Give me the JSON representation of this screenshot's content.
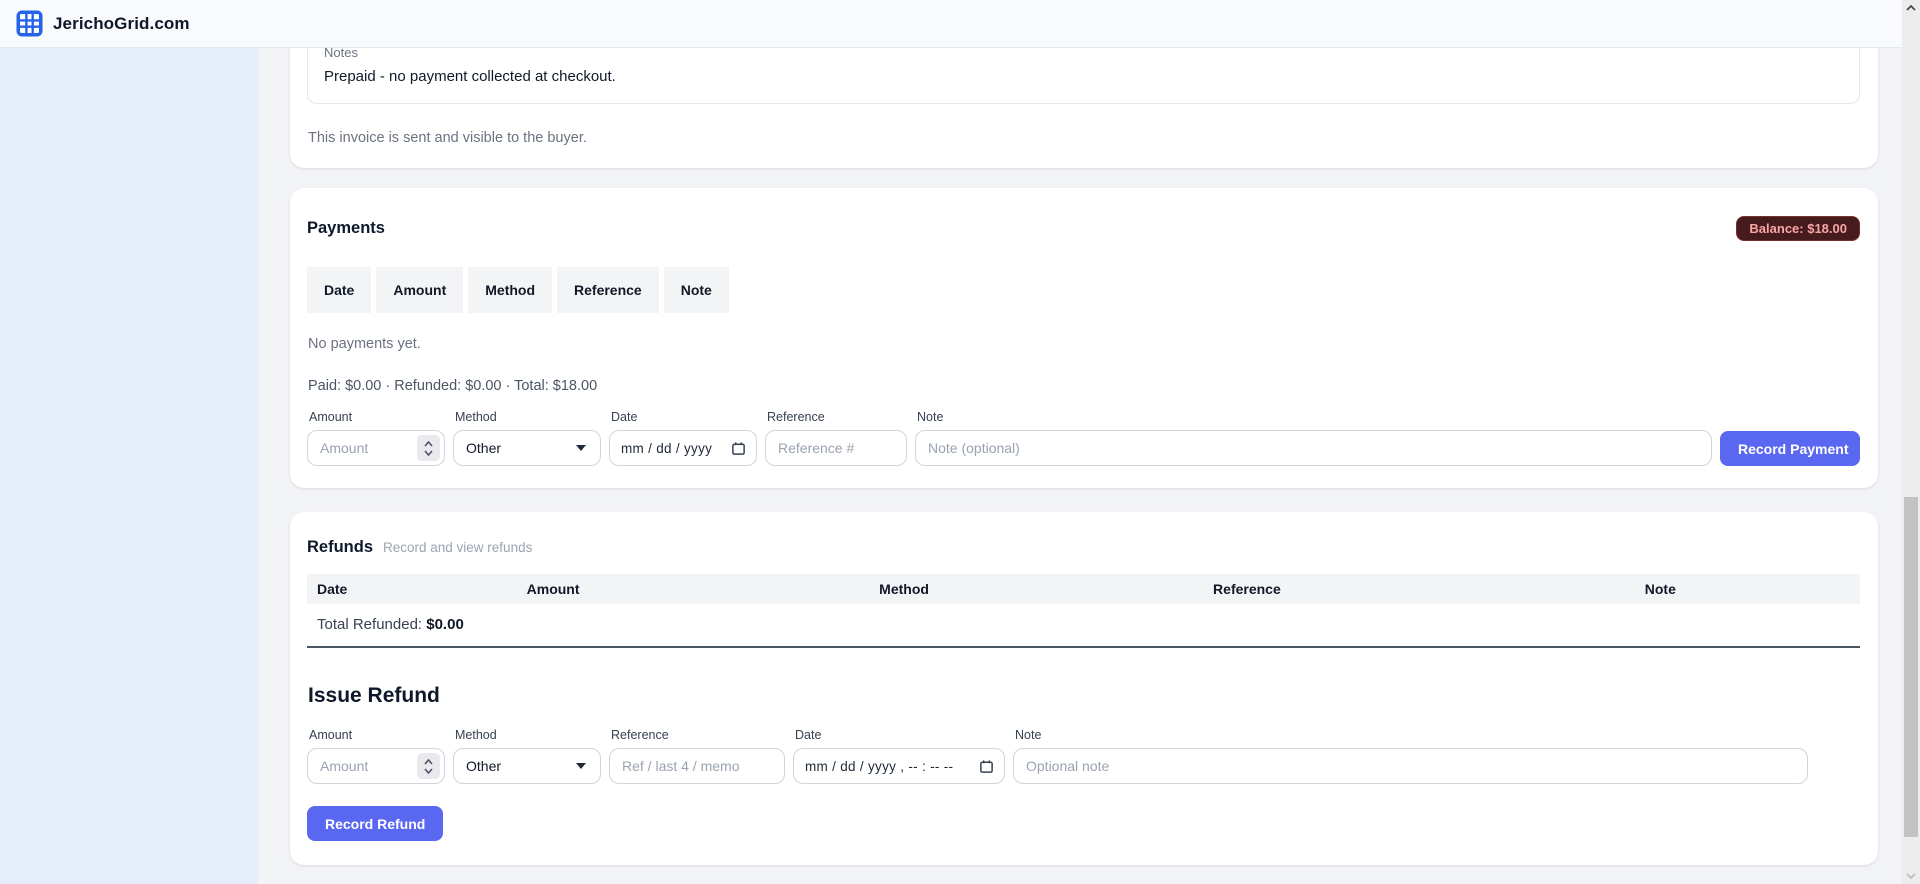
{
  "header": {
    "brand": "JerichoGrid.com"
  },
  "invoice_card": {
    "notes_label": "Notes",
    "notes_text": "Prepaid - no payment collected at checkout.",
    "status_text": "This invoice is sent and visible to the buyer."
  },
  "payments": {
    "title": "Payments",
    "balance_badge": "Balance: $18.00",
    "table_headers": [
      "Date",
      "Amount",
      "Method",
      "Reference",
      "Note"
    ],
    "empty_text": "No payments yet.",
    "summary": "Paid: $0.00 · Refunded: $0.00 · Total: $18.00",
    "form": {
      "amount_label": "Amount",
      "amount_placeholder": "Amount",
      "method_label": "Method",
      "method_value": "Other",
      "date_label": "Date",
      "date_placeholder": "mm / dd / yyyy",
      "reference_label": "Reference",
      "reference_placeholder": "Reference #",
      "note_label": "Note",
      "note_placeholder": "Note (optional)",
      "submit_label": "Record Payment"
    }
  },
  "refunds": {
    "title": "Refunds",
    "subtitle": "Record and view refunds",
    "table_headers": [
      "Date",
      "Amount",
      "Method",
      "Reference",
      "Note"
    ],
    "total_label": "Total Refunded:",
    "total_value": "$0.00",
    "issue_title": "Issue Refund",
    "form": {
      "amount_label": "Amount",
      "amount_placeholder": "Amount",
      "method_label": "Method",
      "method_value": "Other",
      "reference_label": "Reference",
      "reference_placeholder": "Ref / last 4 / memo",
      "date_label": "Date",
      "date_placeholder": "mm / dd / yyyy ,  -- : --  --",
      "note_label": "Note",
      "note_placeholder": "Optional note",
      "submit_label": "Record Refund"
    }
  },
  "colors": {
    "accent_button": "#5a67f0",
    "brand_blue": "#2563eb",
    "badge_bg": "#451b1d",
    "badge_text": "#f8a6a6",
    "sidebar_bg": "#e7eefb"
  }
}
